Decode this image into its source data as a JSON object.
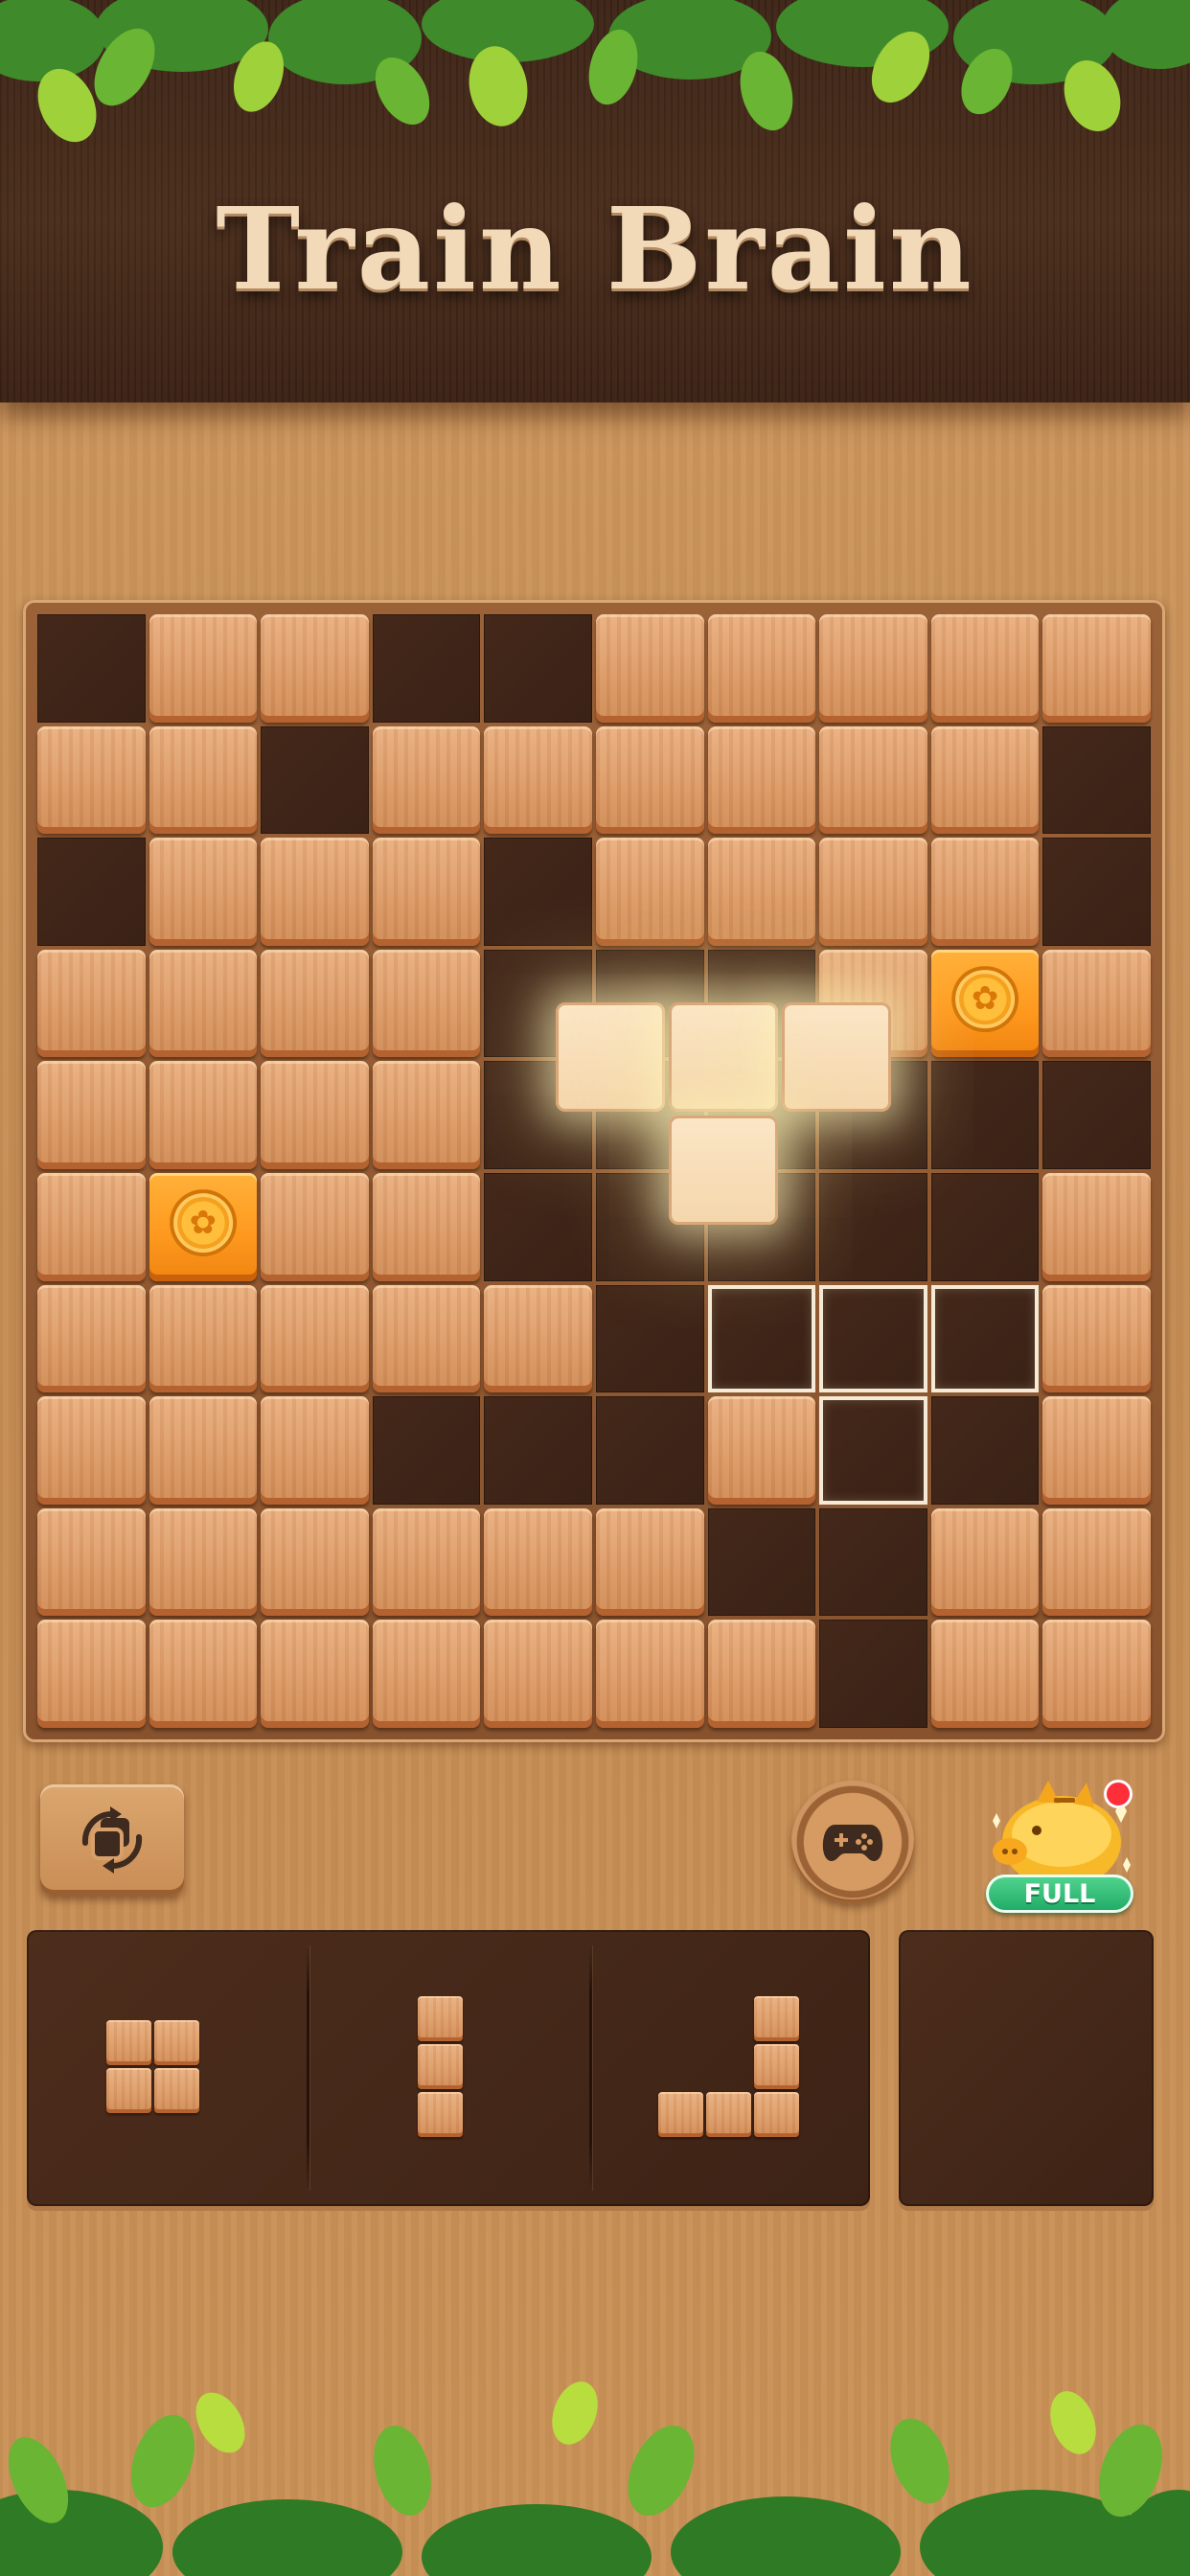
{
  "header": {
    "title": "Train Brain"
  },
  "board": {
    "rows": 10,
    "cols": 10,
    "grid": [
      "_WW__WWWWW",
      "WW_WWWWWW_",
      "_WWW_WWWW_",
      "WWWW___WCW",
      "WWWW______",
      "WCWW_____W",
      "WWWWW_TTTW",
      "WWW___WT_W",
      "WWWWWW__WW",
      "WWWWWWW_WW"
    ],
    "legend": {
      "W": "wood-block",
      "_": "empty",
      "C": "coin-block",
      "T": "target-outline"
    },
    "dragged_piece": {
      "shape": "T-tetromino",
      "cells": [
        [
          0,
          0
        ],
        [
          0,
          1
        ],
        [
          0,
          2
        ],
        [
          1,
          1
        ]
      ]
    }
  },
  "controls": {
    "rotate": {
      "icon": "rotate-icon"
    },
    "game": {
      "icon": "gamepad-icon"
    },
    "piggy_bank": {
      "icon": "piggy-bank-icon",
      "badge_label": "FULL",
      "notification": true
    }
  },
  "tray": {
    "pieces": [
      {
        "name": "square-2x2",
        "cells": [
          [
            0,
            0
          ],
          [
            0,
            1
          ],
          [
            1,
            0
          ],
          [
            1,
            1
          ]
        ]
      },
      {
        "name": "line-vertical-3",
        "cells": [
          [
            0,
            0
          ],
          [
            1,
            0
          ],
          [
            2,
            0
          ]
        ]
      },
      {
        "name": "j-shape-5",
        "cells": [
          [
            0,
            2
          ],
          [
            1,
            2
          ],
          [
            2,
            0
          ],
          [
            2,
            1
          ],
          [
            2,
            2
          ]
        ]
      }
    ],
    "hold_slot": {
      "pieces": []
    }
  },
  "colors": {
    "wood": "#dc9b68",
    "empty": "#3e2417",
    "coin": "#ff9a1f",
    "badge": "#2fbf77",
    "notification": "#ff2f3a",
    "title": "#f2d9b8"
  }
}
